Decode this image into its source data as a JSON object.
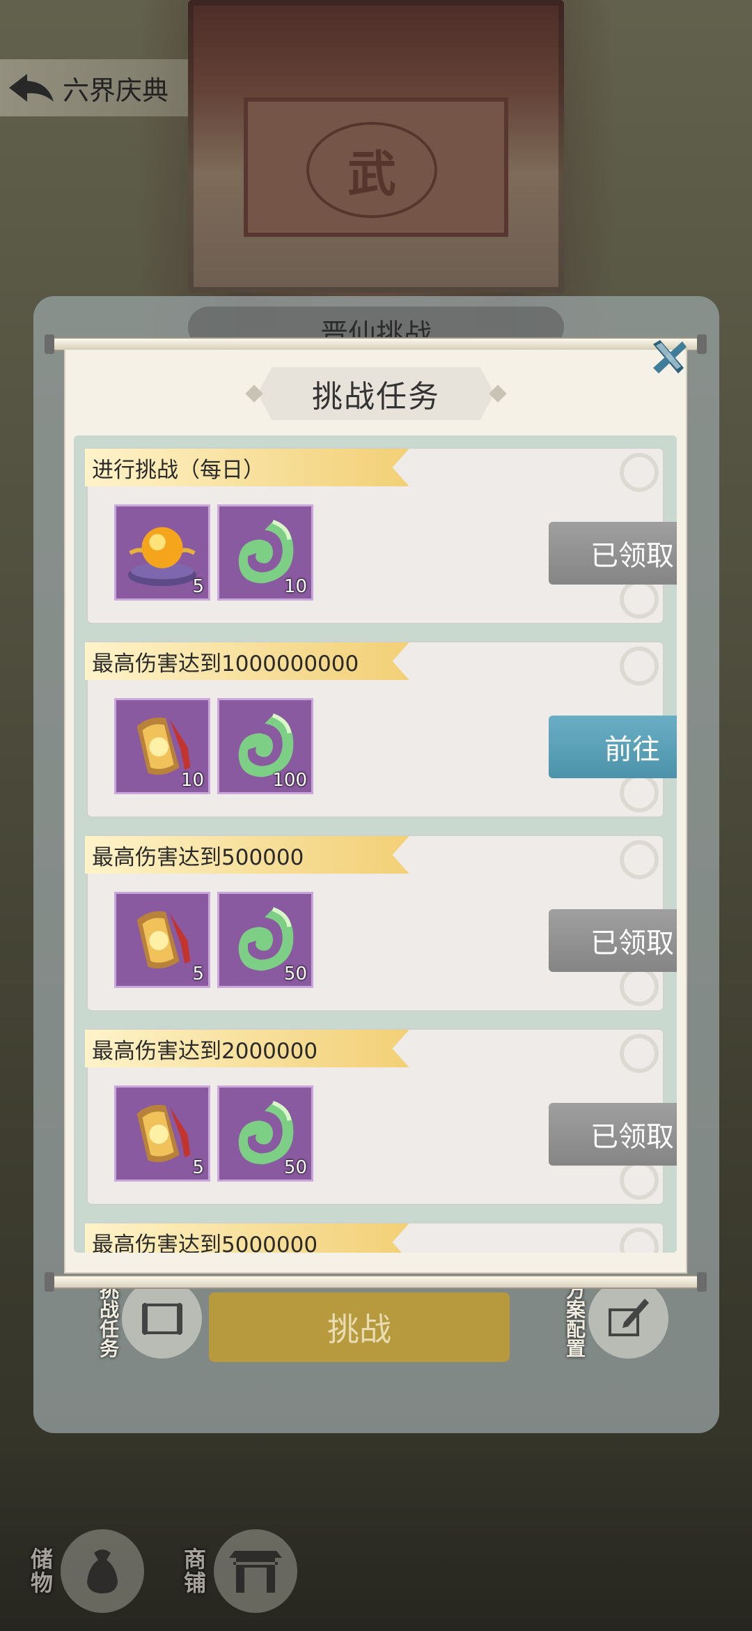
{
  "nav": {
    "back_title": "六界庆典"
  },
  "background": {
    "hall_seal": "武",
    "bottom_buttons": [
      {
        "label": "储物",
        "icon": "bag-icon"
      },
      {
        "label": "商铺",
        "icon": "shop-gate-icon"
      }
    ]
  },
  "outer_panel": {
    "title": "晋仙挑战",
    "challenge_button": "挑战",
    "left_tag": "挑战任务",
    "right_tag": "方案配置"
  },
  "dialog": {
    "title": "挑战任务",
    "tasks": [
      {
        "title": "进行挑战（每日）",
        "rewards": [
          {
            "icon": "golden-orb-on-cushion-icon",
            "qty": "5"
          },
          {
            "icon": "jade-curl-icon",
            "qty": "10"
          }
        ],
        "button": "已领取",
        "state": "claimed"
      },
      {
        "title": "最高伤害达到1000000000",
        "rewards": [
          {
            "icon": "golden-token-icon",
            "qty": "10"
          },
          {
            "icon": "jade-curl-icon",
            "qty": "100"
          }
        ],
        "button": "前往",
        "state": "goto"
      },
      {
        "title": "最高伤害达到500000",
        "rewards": [
          {
            "icon": "golden-token-icon",
            "qty": "5"
          },
          {
            "icon": "jade-curl-icon",
            "qty": "50"
          }
        ],
        "button": "已领取",
        "state": "claimed"
      },
      {
        "title": "最高伤害达到2000000",
        "rewards": [
          {
            "icon": "golden-token-icon",
            "qty": "5"
          },
          {
            "icon": "jade-curl-icon",
            "qty": "50"
          }
        ],
        "button": "已领取",
        "state": "claimed"
      },
      {
        "title": "最高伤害达到5000000"
      }
    ]
  },
  "colors": {
    "ribbon": "#f5d98c",
    "claimed_button": "#8f8f8f",
    "goto_button": "#5aa2b8",
    "reward_bg": "#8a5aa0"
  }
}
